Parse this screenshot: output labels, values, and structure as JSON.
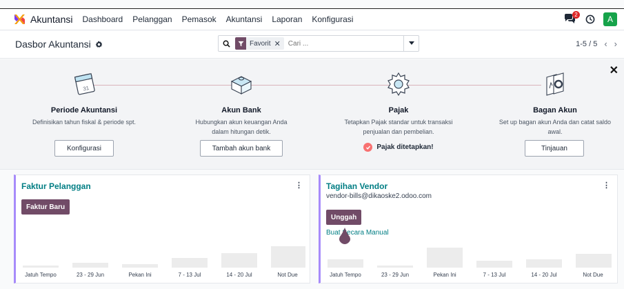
{
  "app": {
    "name": "Akuntansi",
    "menu": [
      "Dashboard",
      "Pelanggan",
      "Pemasok",
      "Akuntansi",
      "Laporan",
      "Konfigurasi"
    ],
    "chat_badge": "2",
    "avatar_letter": "A",
    "colors": {
      "brand": "#714b67",
      "teal": "#017e84",
      "avatar": "#16a34a",
      "badge": "#dc2626"
    }
  },
  "control": {
    "page_title": "Dasbor Akuntansi",
    "facet_label": "Favorit",
    "search_placeholder": "Cari ...",
    "pager": "1-5 / 5"
  },
  "onboarding": {
    "steps": [
      {
        "title": "Periode Akuntansi",
        "desc": "Definisikan tahun fiskal & periode spt.",
        "button": "Konfigurasi",
        "icon": "calendar-icon"
      },
      {
        "title": "Akun Bank",
        "desc": "Hubungkan akun keuangan Anda dalam hitungan detik.",
        "button": "Tambah akun bank",
        "icon": "puzzle-icon"
      },
      {
        "title": "Pajak",
        "desc": "Tetapkan Pajak standar untuk transaksi penjualan dan pembelian.",
        "done": "Pajak ditetapkan!",
        "icon": "gear-icon"
      },
      {
        "title": "Bagan Akun",
        "desc": "Set up bagan akun Anda dan catat saldo awal.",
        "button": "Tinjauan",
        "icon": "document-chart-icon"
      }
    ]
  },
  "journals": {
    "customer": {
      "title": "Faktur Pelanggan",
      "button": "Faktur Baru",
      "chart_ticks": [
        "Jatuh Tempo",
        "23 - 29 Jun",
        "Pekan Ini",
        "7 - 13 Jul",
        "14 - 20 Jul",
        "Not Due"
      ]
    },
    "vendor": {
      "title": "Tagihan Vendor",
      "email": "vendor-bills@dikaoske2.odoo.com",
      "button": "Unggah",
      "link": "Buat Secara Manual",
      "chart_ticks": [
        "Jatuh Tempo",
        "23 - 29 Jun",
        "Pekan Ini",
        "7 - 13 Jul",
        "14 - 20 Jul",
        "Not Due"
      ]
    }
  }
}
